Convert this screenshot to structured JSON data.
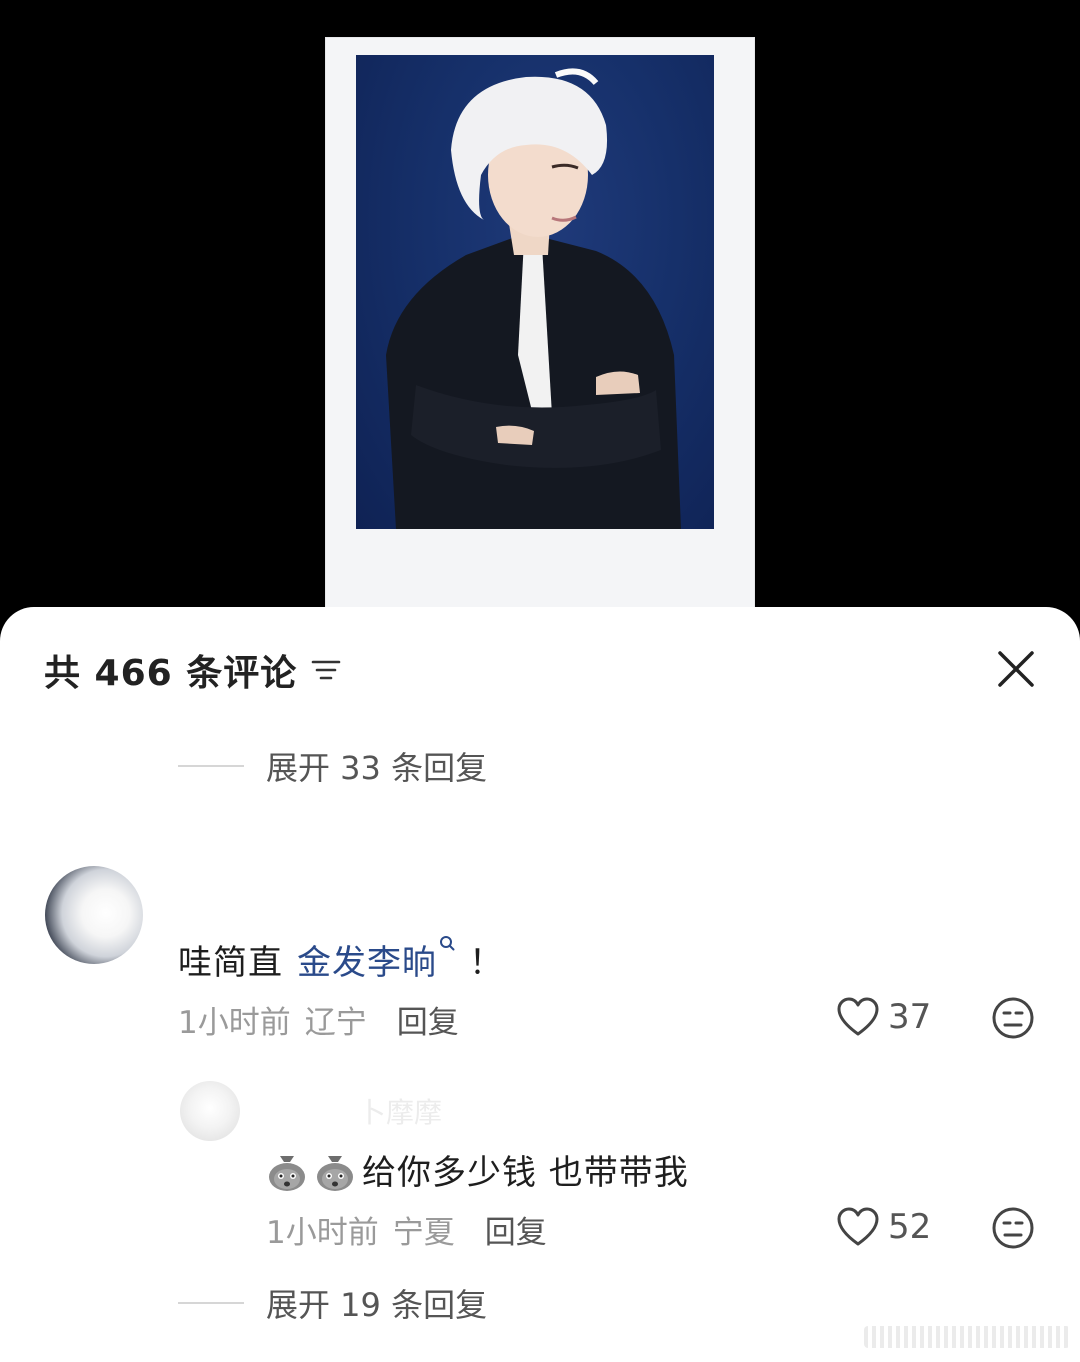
{
  "header": {
    "comment_count": "共 466 条评论"
  },
  "expand_top": {
    "label": "展开 33 条回复"
  },
  "comment_main": {
    "text_prefix": "哇简直",
    "tag": "金发李晌",
    "text_suffix": "！",
    "time": "1小时前",
    "location": "辽宁",
    "reply_label": "回复",
    "likes": "37"
  },
  "reply": {
    "username": "卜摩摩",
    "text": "给你多少钱 也带带我",
    "time": "1小时前",
    "location": "宁夏",
    "reply_label": "回复",
    "likes": "52"
  },
  "expand_bottom": {
    "label": "展开 19 条回复"
  },
  "icons": {
    "sort": "sort-icon",
    "close": "close-icon",
    "like": "heart-icon",
    "face": "neutral-face-icon",
    "search": "search-icon",
    "emoji": "money-sack-emoji-icon"
  },
  "colors": {
    "tag_link": "#2a4a8a",
    "meta_gray": "#9a9a9a",
    "photo_bg": "#16306a"
  }
}
